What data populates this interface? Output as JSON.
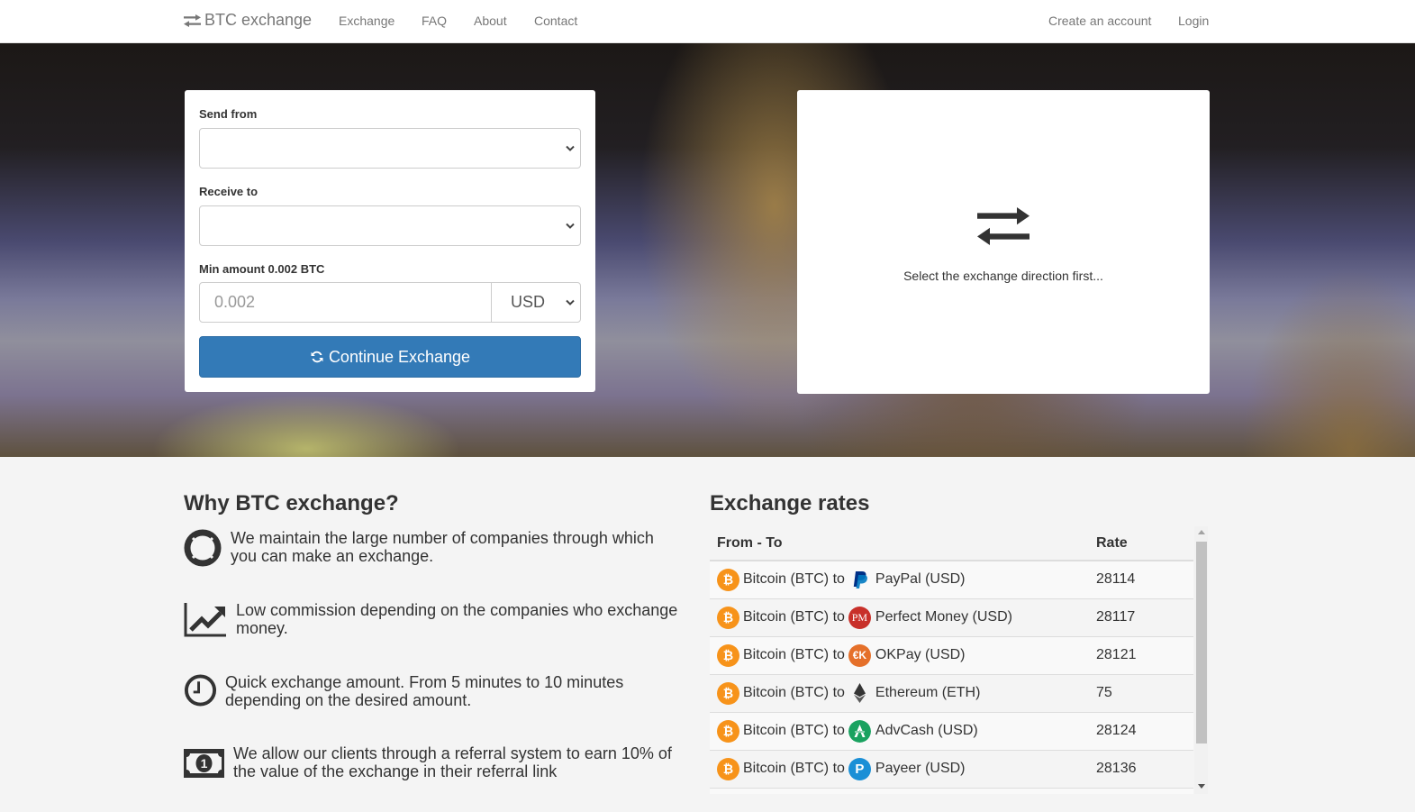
{
  "navbar": {
    "brand": "BTC exchange",
    "brand_icon": "exchange-arrows-icon",
    "links": [
      {
        "label": "Exchange"
      },
      {
        "label": "FAQ"
      },
      {
        "label": "About"
      },
      {
        "label": "Contact"
      }
    ],
    "right_links": [
      {
        "label": "Create an account"
      },
      {
        "label": "Login"
      }
    ]
  },
  "form": {
    "send_from_label": "Send from",
    "send_from_value": "",
    "receive_to_label": "Receive to",
    "receive_to_value": "",
    "min_amount_label": "Min amount 0.002 BTC",
    "amount_placeholder": "0.002",
    "amount_value": "",
    "currency_selected": "USD",
    "continue_label": "Continue Exchange",
    "continue_icon": "refresh-icon"
  },
  "info_panel": {
    "icon": "exchange-arrows-icon",
    "message": "Select the exchange direction first..."
  },
  "why": {
    "title": "Why BTC exchange?",
    "features": [
      {
        "icon": "lifebuoy-icon",
        "text": "We maintain the large number of companies through which you can make an exchange."
      },
      {
        "icon": "line-chart-icon",
        "text": "Low commission depending on the companies who exchange money."
      },
      {
        "icon": "clock-icon",
        "text": "Quick exchange amount. From 5 minutes to 10 minutes depending on the desired amount."
      },
      {
        "icon": "money-bill-icon",
        "text": "We allow our clients through a referral system to earn 10% of the value of the exchange in their referral link"
      }
    ]
  },
  "rates": {
    "title": "Exchange rates",
    "columns": [
      "From - To",
      "Rate"
    ],
    "rows": [
      {
        "from": "Bitcoin (BTC) to",
        "to": "PayPal (USD)",
        "to_icon": "paypal-icon",
        "rate": "28114"
      },
      {
        "from": "Bitcoin (BTC) to",
        "to": "Perfect Money (USD)",
        "to_icon": "perfect-money-icon",
        "rate": "28117"
      },
      {
        "from": "Bitcoin (BTC) to",
        "to": "OKPay (USD)",
        "to_icon": "okpay-icon",
        "rate": "28121"
      },
      {
        "from": "Bitcoin (BTC) to",
        "to": "Ethereum (ETH)",
        "to_icon": "ethereum-icon",
        "rate": "75"
      },
      {
        "from": "Bitcoin (BTC) to",
        "to": "AdvCash (USD)",
        "to_icon": "advcash-icon",
        "rate": "28124"
      },
      {
        "from": "Bitcoin (BTC) to",
        "to": "Payeer (USD)",
        "to_icon": "payeer-icon",
        "rate": "28136"
      }
    ]
  },
  "colors": {
    "primary_button": "#337ab7",
    "bitcoin": "#f7931a",
    "paypal": "#003087",
    "perfect_money": "#c8302a",
    "okpay": "#e5702a",
    "advcash": "#1aa260",
    "payeer": "#1a8fd6"
  }
}
